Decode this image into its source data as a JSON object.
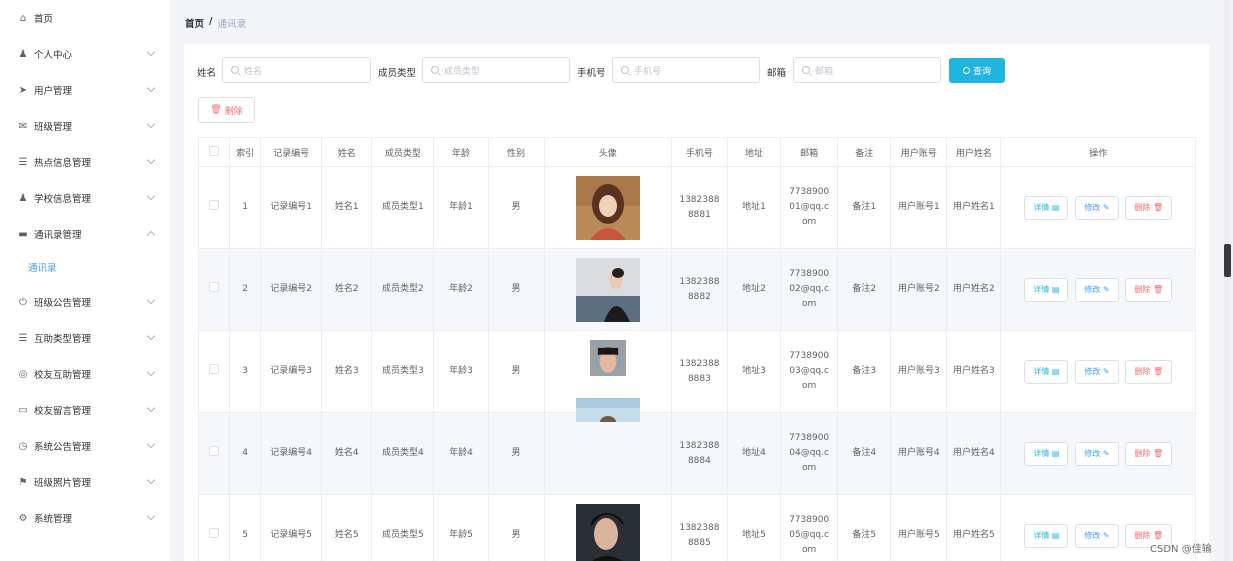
{
  "sidebar": {
    "items": [
      {
        "icon": "home-icon",
        "glyph": "⌂",
        "label": "首页",
        "expandable": false
      },
      {
        "icon": "user-icon",
        "glyph": "♟",
        "label": "个人中心",
        "expandable": true
      },
      {
        "icon": "send-icon",
        "glyph": "➤",
        "label": "用户管理",
        "expandable": true
      },
      {
        "icon": "mail-icon",
        "glyph": "✉",
        "label": "班级管理",
        "expandable": true
      },
      {
        "icon": "list-icon",
        "glyph": "☰",
        "label": "热点信息管理",
        "expandable": true
      },
      {
        "icon": "person-icon",
        "glyph": "♟",
        "label": "学校信息管理",
        "expandable": true
      },
      {
        "icon": "folder-icon",
        "glyph": "▬",
        "label": "通讯录管理",
        "expandable": true,
        "open": true
      },
      {
        "icon": "power-icon",
        "glyph": "⏻",
        "label": "班级公告管理",
        "expandable": true
      },
      {
        "icon": "menu-icon",
        "glyph": "☰",
        "label": "互助类型管理",
        "expandable": true
      },
      {
        "icon": "globe-icon",
        "glyph": "◎",
        "label": "校友互助管理",
        "expandable": true
      },
      {
        "icon": "comment-icon",
        "glyph": "▭",
        "label": "校友留言管理",
        "expandable": true
      },
      {
        "icon": "compass-icon",
        "glyph": "◷",
        "label": "系统公告管理",
        "expandable": true
      },
      {
        "icon": "flag-icon",
        "glyph": "⚑",
        "label": "班级照片管理",
        "expandable": true
      },
      {
        "icon": "settings-icon",
        "glyph": "⚙",
        "label": "系统管理",
        "expandable": true
      }
    ],
    "submenu_active": "通讯录"
  },
  "breadcrumb": {
    "home": "首页",
    "separator": "/",
    "current": "通讯录"
  },
  "search": {
    "fields": [
      {
        "label": "姓名",
        "placeholder": "姓名"
      },
      {
        "label": "成员类型",
        "placeholder": "成员类型"
      },
      {
        "label": "手机号",
        "placeholder": "手机号"
      },
      {
        "label": "邮箱",
        "placeholder": "邮箱"
      }
    ],
    "query_label": "查询"
  },
  "toolbar": {
    "delete_label": "删除"
  },
  "table": {
    "headers": [
      "",
      "索引",
      "记录编号",
      "姓名",
      "成员类型",
      "年龄",
      "性别",
      "头像",
      "手机号",
      "地址",
      "邮箱",
      "备注",
      "用户账号",
      "用户姓名",
      "操作"
    ],
    "rows": [
      {
        "index": "1",
        "code": "记录编号1",
        "name": "姓名1",
        "type": "成员类型1",
        "age": "年龄1",
        "gender": "男",
        "phone1": "1382388",
        "phone2": "8881",
        "address": "地址1",
        "email1": "7738900",
        "email2": "01@qq.c",
        "email3": "om",
        "note": "备注1",
        "account": "用户账号1",
        "username": "用户姓名1"
      },
      {
        "index": "2",
        "code": "记录编号2",
        "name": "姓名2",
        "type": "成员类型2",
        "age": "年龄2",
        "gender": "男",
        "phone1": "1382388",
        "phone2": "8882",
        "address": "地址2",
        "email1": "7738900",
        "email2": "02@qq.c",
        "email3": "om",
        "note": "备注2",
        "account": "用户账号2",
        "username": "用户姓名2"
      },
      {
        "index": "3",
        "code": "记录编号3",
        "name": "姓名3",
        "type": "成员类型3",
        "age": "年龄3",
        "gender": "男",
        "phone1": "1382388",
        "phone2": "8883",
        "address": "地址3",
        "email1": "7738900",
        "email2": "03@qq.c",
        "email3": "om",
        "note": "备注3",
        "account": "用户账号3",
        "username": "用户姓名3"
      },
      {
        "index": "4",
        "code": "记录编号4",
        "name": "姓名4",
        "type": "成员类型4",
        "age": "年龄4",
        "gender": "男",
        "phone1": "1382388",
        "phone2": "8884",
        "address": "地址4",
        "email1": "7738900",
        "email2": "04@qq.c",
        "email3": "om",
        "note": "备注4",
        "account": "用户账号4",
        "username": "用户姓名4"
      },
      {
        "index": "5",
        "code": "记录编号5",
        "name": "姓名5",
        "type": "成员类型5",
        "age": "年龄5",
        "gender": "男",
        "phone1": "1382388",
        "phone2": "8885",
        "address": "地址5",
        "email1": "7738900",
        "email2": "05@qq.c",
        "email3": "om",
        "note": "备注5",
        "account": "用户账号5",
        "username": "用户姓名5"
      }
    ],
    "actions": {
      "detail": "详情",
      "edit": "修改",
      "remove": "删除"
    }
  },
  "colors": {
    "accent": "#1fb5e0",
    "link": "#409eff",
    "danger": "#f56c6c"
  },
  "watermark": "CSDN @佳输"
}
